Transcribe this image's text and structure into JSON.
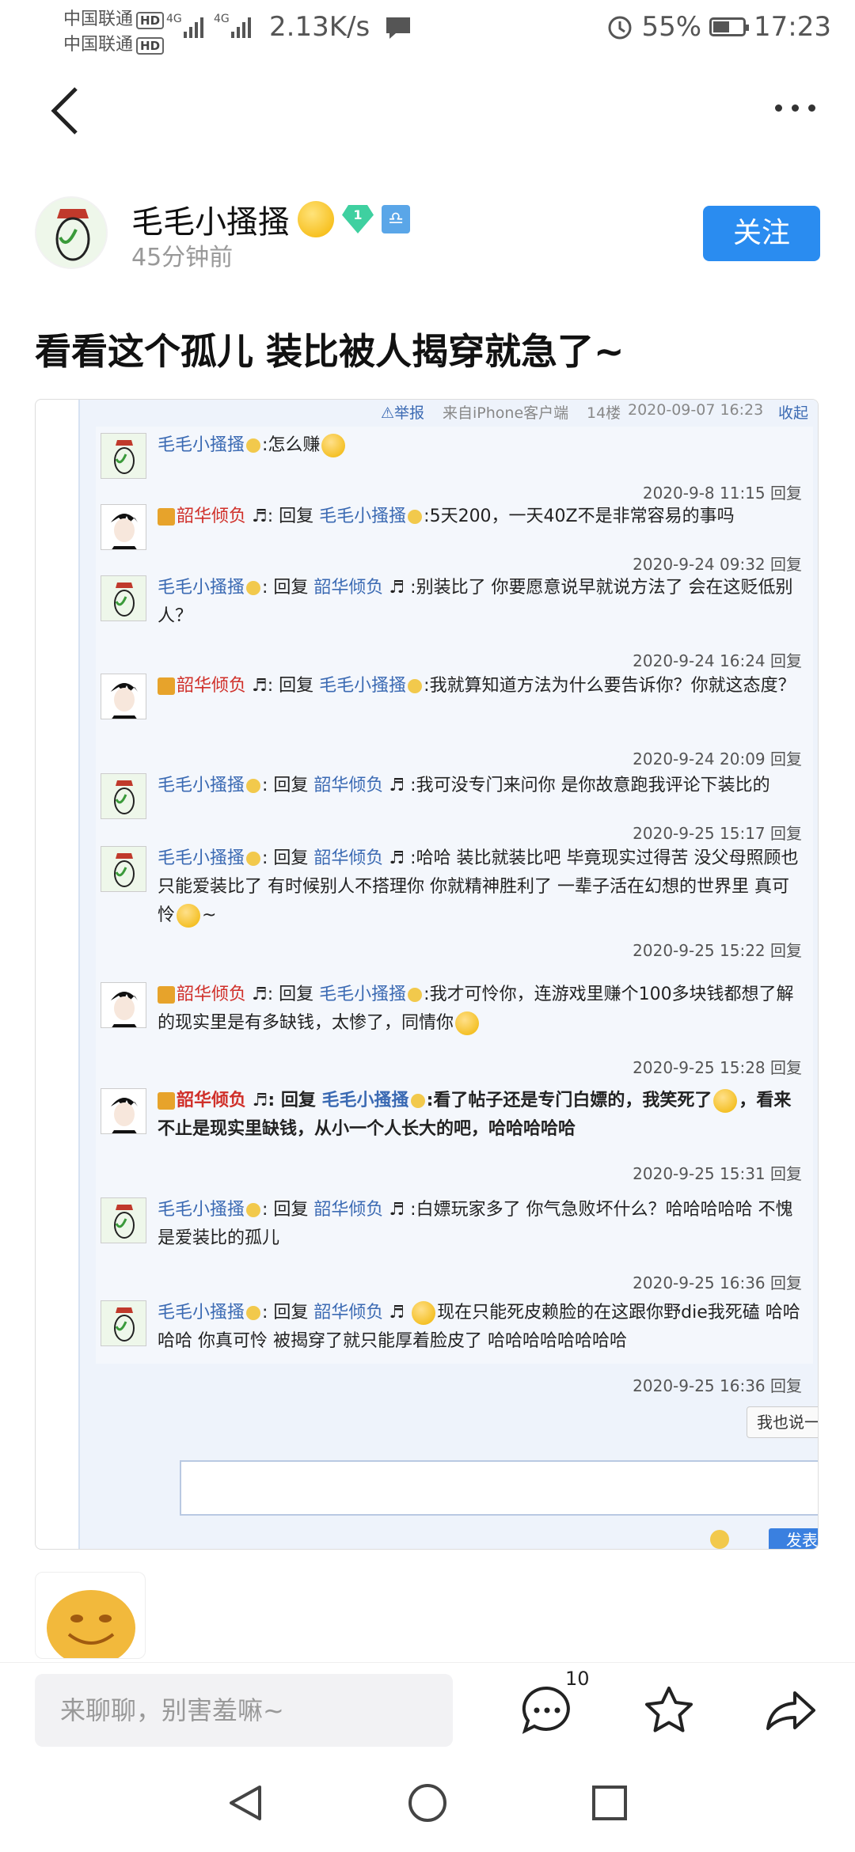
{
  "status_bar": {
    "carrier_1": "中国联通",
    "carrier_2": "中国联通",
    "hd_label": "HD",
    "signal_1": "4G",
    "signal_2": "4G",
    "net_speed": "2.13K/s",
    "battery_text": "55%",
    "battery_level": 0.55,
    "time": "17:23"
  },
  "post": {
    "author_name": "毛毛小搔搔",
    "level_badge": "1",
    "time_ago": "45分钟前",
    "follow_label": "关注",
    "title": "看看这个孤儿 装比被人揭穿就急了~"
  },
  "screenshot": {
    "report": "⚠举报",
    "source": "来自iPhone客户端",
    "floor": "14楼",
    "date": "2020-09-07 16:23",
    "fold": "收起回复",
    "reply_word": "回复",
    "comments": [
      {
        "user": "毛毛小搔搔",
        "text": ":怎么赚",
        "meta": "2020-9-8 11:15 回复"
      },
      {
        "user": "韶华倾负",
        "to": "毛毛小搔搔",
        "text": ":5天200，一天40Z不是非常容易的事吗",
        "meta": "2020-9-24 09:32 回复"
      },
      {
        "user": "毛毛小搔搔",
        "to": "韶华倾负",
        "text": ":别装比了 你要愿意说早就说方法了 会在这贬低别人？",
        "meta": "2020-9-24 16:24 回复"
      },
      {
        "user": "韶华倾负",
        "to": "毛毛小搔搔",
        "text": ":我就算知道方法为什么要告诉你？你就这态度？",
        "meta": "2020-9-24 20:09 回复"
      },
      {
        "user": "毛毛小搔搔",
        "to": "韶华倾负",
        "text": ":我可没专门来问你 是你故意跑我评论下装比的",
        "meta": "2020-9-25 15:17 回复"
      },
      {
        "user": "毛毛小搔搔",
        "to": "韶华倾负",
        "text": ":哈哈 装比就装比吧 毕竟现实过得苦 没父母照顾也只能爱装比了 有时候别人不搭理你 你就精神胜利了 一辈子活在幻想的世界里 真可怜",
        "tail": "~",
        "meta": "2020-9-25 15:22 回复"
      },
      {
        "user": "韶华倾负",
        "to": "毛毛小搔搔",
        "text": ":我才可怜你，连游戏里赚个100多块钱都想了解的现实里是有多缺钱，太惨了，同情你",
        "meta": "2020-9-25 15:28 回复"
      },
      {
        "user": "韶华倾负",
        "to": "毛毛小搔搔",
        "text": ":看了帖子还是专门白嫖的，我笑死了",
        "tail": "，看来不止是现实里缺钱，从小一个人长大的吧，哈哈哈哈哈",
        "meta": "2020-9-25 15:31 回复"
      },
      {
        "user": "毛毛小搔搔",
        "to": "韶华倾负",
        "text": ":白嫖玩家多了 你气急败坏什么？哈哈哈哈哈 不愧是爱装比的孤儿",
        "meta": "2020-9-25 16:36 回复"
      },
      {
        "user": "毛毛小搔搔",
        "to": "韶华倾负",
        "text": "现在只能死皮赖脸的在这跟你野die我死磕 哈哈哈哈 你真可怜 被揭穿了就只能厚着脸皮了 哈哈哈哈哈哈哈哈",
        "meta": "2020-9-25 16:36 回复"
      }
    ],
    "say_one": "我也说一句",
    "send": "发表"
  },
  "bottom_bar": {
    "chat_placeholder": "来聊聊，别害羞嘛~",
    "comment_count": "10"
  },
  "colors": {
    "accent": "#2a8cf0",
    "user_blue": "#3b6ab3",
    "user_red": "#d0302a"
  }
}
